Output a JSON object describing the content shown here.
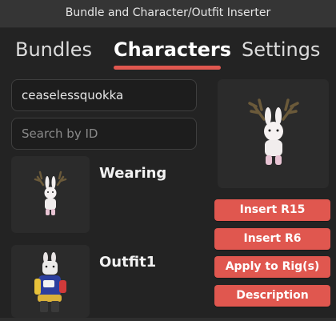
{
  "window": {
    "title": "Bundle and Character/Outfit Inserter"
  },
  "tabs": [
    {
      "label": "Bundles",
      "active": false
    },
    {
      "label": "Characters",
      "active": true
    },
    {
      "label": "Settings",
      "active": false
    }
  ],
  "search": {
    "username_value": "ceaselessquokka",
    "id_placeholder": "Search by ID"
  },
  "items": [
    {
      "label": "Wearing",
      "thumbnail": "bunny-deer-avatar"
    },
    {
      "label": "Outfit1",
      "thumbnail": "bunny-outfit-avatar"
    }
  ],
  "preview": {
    "thumbnail": "bunny-deer-avatar-large"
  },
  "actions": {
    "insert_r15": "Insert R15",
    "insert_r6": "Insert R6",
    "apply_to_rig": "Apply to Rig(s)",
    "description": "Description"
  },
  "colors": {
    "accent": "#e0574f",
    "background": "#232323",
    "titlebar": "#353535"
  }
}
